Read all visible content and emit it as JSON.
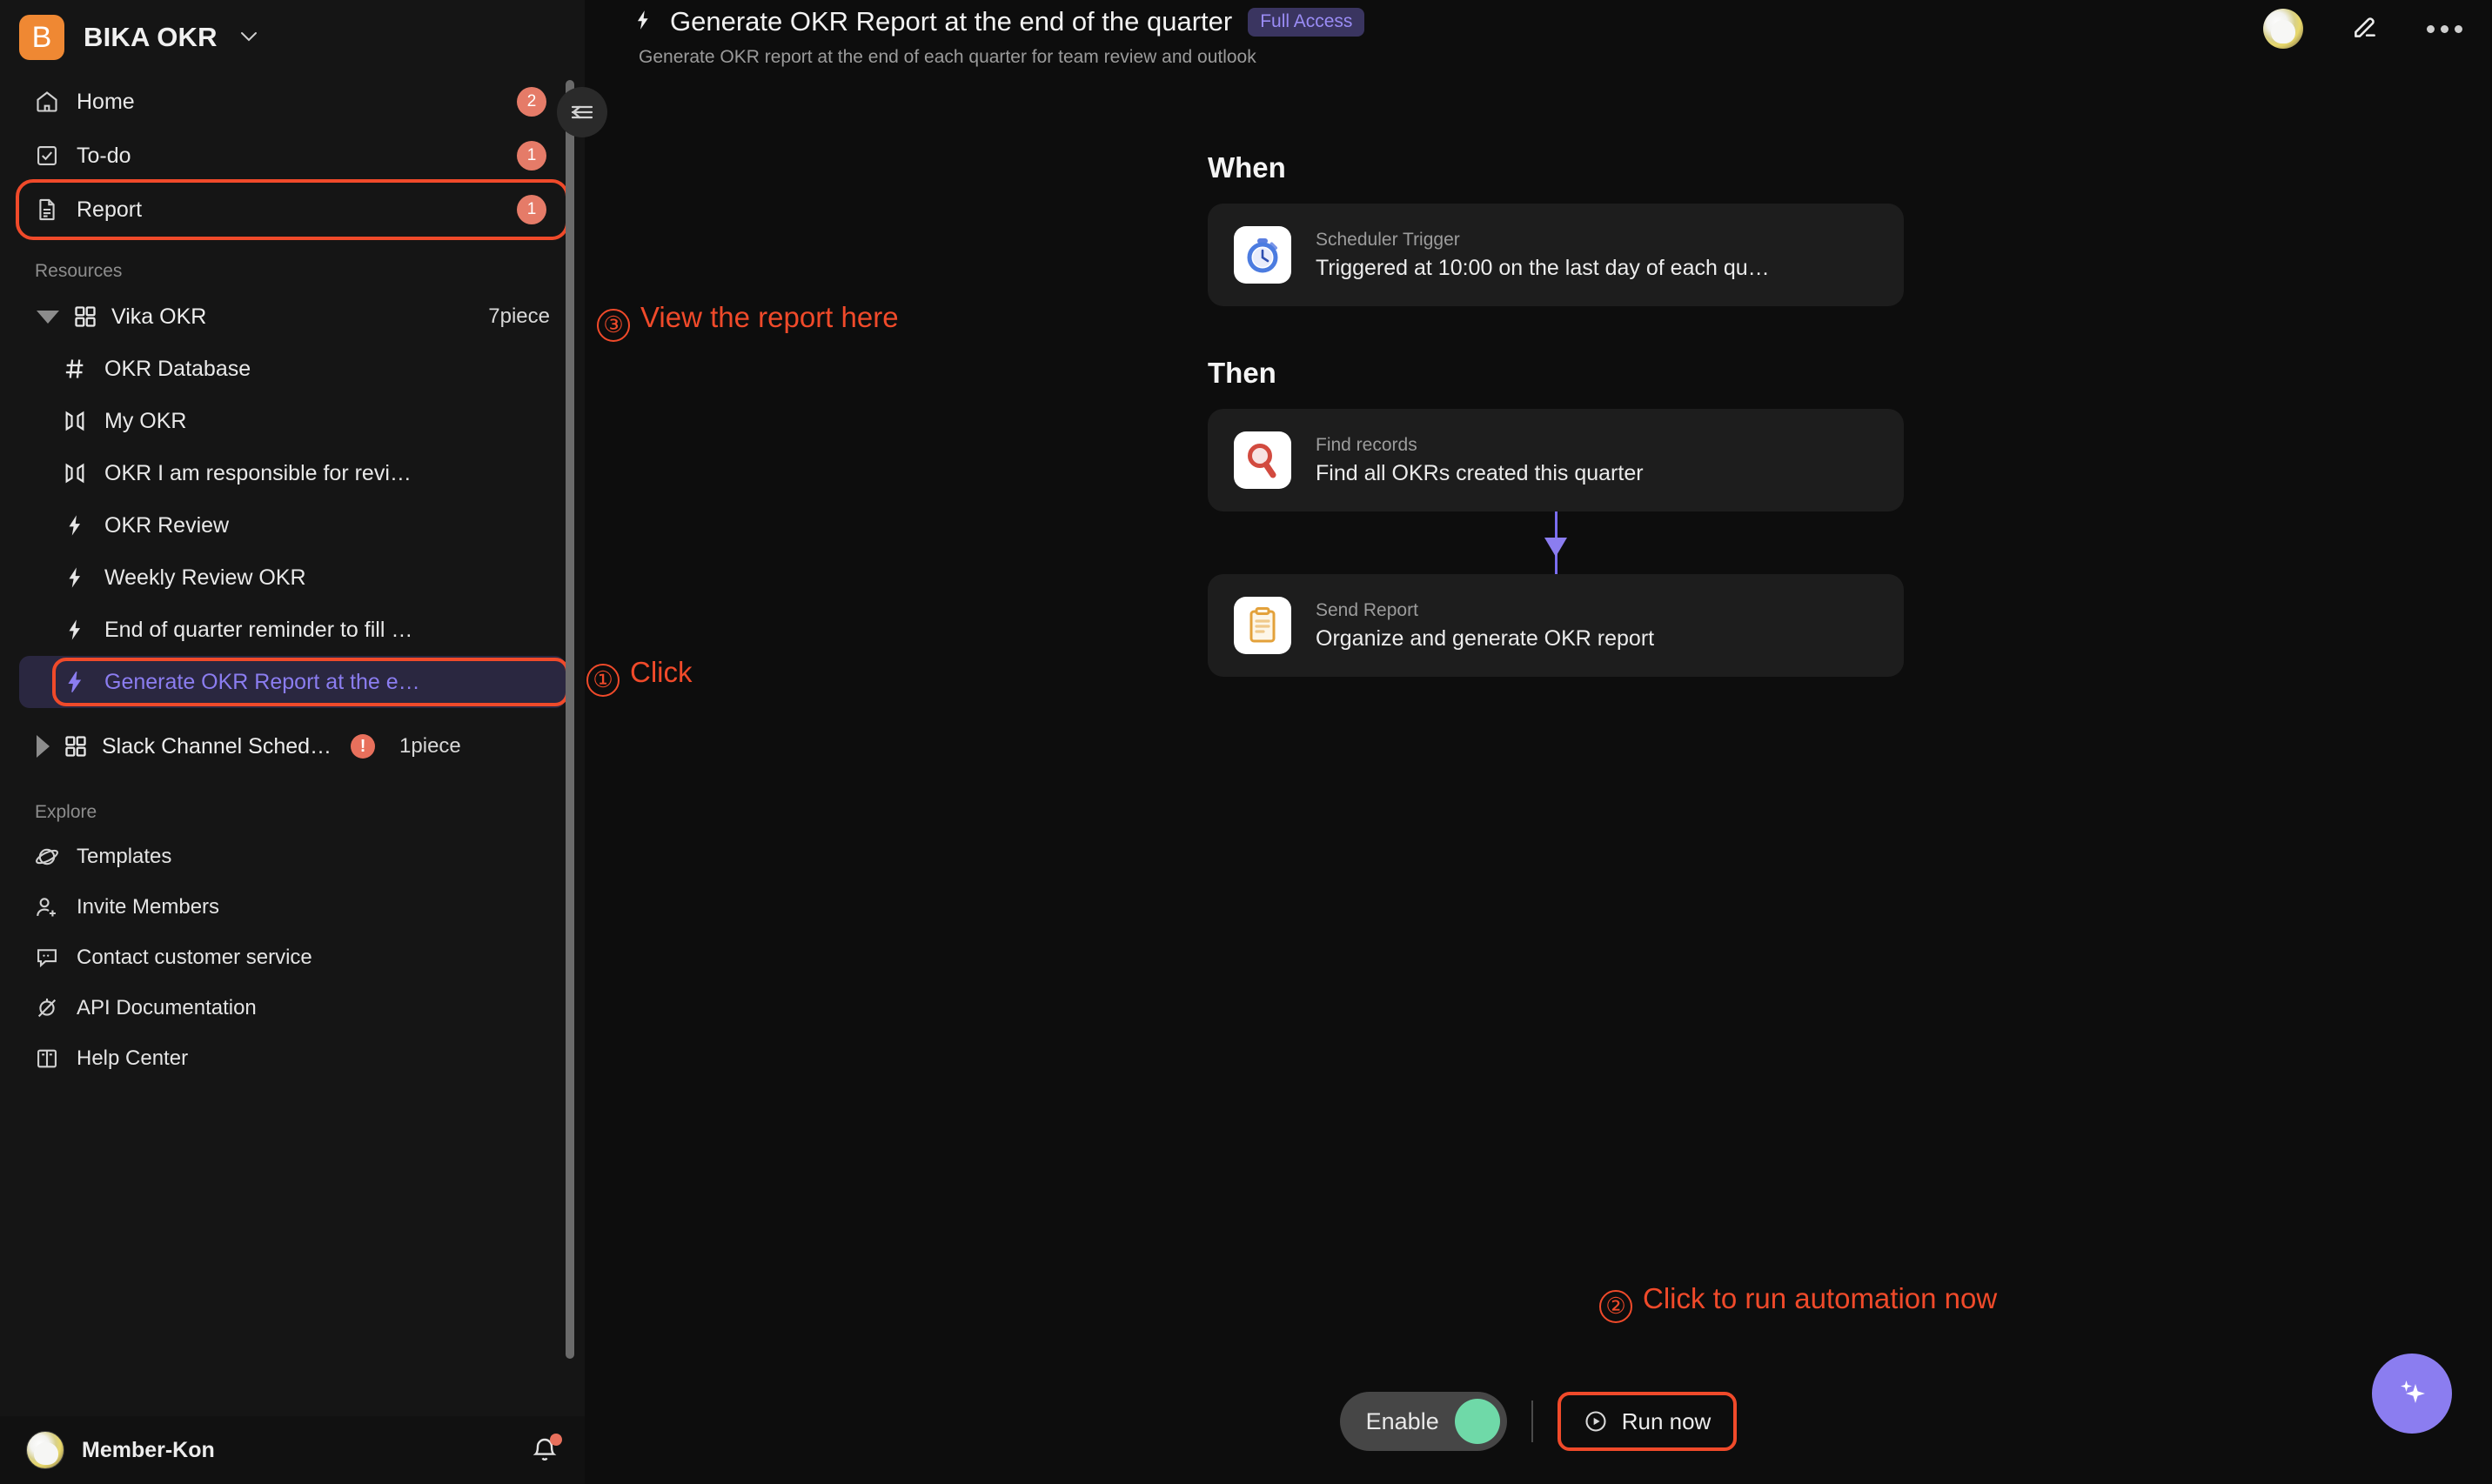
{
  "workspace": {
    "logo_letter": "B",
    "name": "BIKA OKR",
    "caret": "chevron-down"
  },
  "sidebar": {
    "nav": [
      {
        "icon": "home-icon",
        "label": "Home",
        "badge": "2",
        "highlight": false
      },
      {
        "icon": "todo-icon",
        "label": "To-do",
        "badge": "1",
        "highlight": false
      },
      {
        "icon": "report-icon",
        "label": "Report",
        "badge": "1",
        "highlight": true
      }
    ],
    "resources_title": "Resources",
    "groups": [
      {
        "expanded": true,
        "name": "Vika OKR",
        "count": "7piece",
        "error": false,
        "children": [
          {
            "icon": "hash-icon",
            "label": "OKR Database",
            "active": false
          },
          {
            "icon": "mirror-icon",
            "label": "My OKR",
            "active": false
          },
          {
            "icon": "mirror-icon",
            "label": "OKR I am responsible for revi…",
            "active": false
          },
          {
            "icon": "bolt-icon",
            "label": "OKR Review",
            "active": false
          },
          {
            "icon": "bolt-icon",
            "label": "Weekly Review OKR",
            "active": false
          },
          {
            "icon": "bolt-icon",
            "label": "End of quarter reminder to fill …",
            "active": false
          },
          {
            "icon": "bolt-icon",
            "label": "Generate OKR Report at the e…",
            "active": true
          }
        ]
      },
      {
        "expanded": false,
        "name": "Slack Channel Sched…",
        "count": "1piece",
        "error": true,
        "error_mark": "!",
        "children": []
      }
    ],
    "explore_title": "Explore",
    "explore": [
      {
        "icon": "planet-icon",
        "label": "Templates"
      },
      {
        "icon": "user-add-icon",
        "label": "Invite Members"
      },
      {
        "icon": "chat-icon",
        "label": "Contact customer service"
      },
      {
        "icon": "api-icon",
        "label": "API Documentation"
      },
      {
        "icon": "book-icon",
        "label": "Help Center"
      }
    ],
    "user": {
      "name": "Member-Kon",
      "avatar": "cat-avatar",
      "bell": "bell-icon",
      "has_notification": true
    },
    "collapse_icon": "collapse-sidebar-icon"
  },
  "header": {
    "icon": "bolt-icon",
    "title": "Generate OKR Report at the end of the quarter",
    "badge": "Full Access",
    "subtitle": "Generate OKR report at the end of each quarter for team review and outlook",
    "avatar": "cat-avatar",
    "edit_icon": "pencil-icon",
    "more_icon": "more-horizontal-icon"
  },
  "flow": {
    "when_heading": "When",
    "trigger": {
      "icon": "stopwatch-icon",
      "type": "Scheduler Trigger",
      "description": "Triggered at 10:00 on the last day of each qu…"
    },
    "then_heading": "Then",
    "actions": [
      {
        "icon": "magnifier-icon",
        "type": "Find records",
        "description": "Find all OKRs created this quarter"
      },
      {
        "icon": "clipboard-icon",
        "type": "Send Report",
        "description": "Organize and generate OKR report"
      }
    ]
  },
  "footer": {
    "enable_label": "Enable",
    "enable_on": true,
    "run_now_label": "Run now",
    "run_now_icon": "play-circle-icon",
    "ai_icon": "sparkle-icon"
  },
  "annotations": [
    {
      "num": "③",
      "text": "View the report here"
    },
    {
      "num": "①",
      "text": "Click"
    },
    {
      "num": "②",
      "text": "Click to run automation now"
    }
  ],
  "colors": {
    "accent_red": "#f04a2a",
    "brand_orange": "#ef8833",
    "purple": "#8b7df0",
    "toggle_green": "#6fd9a8",
    "badge_red": "#e57b68"
  }
}
